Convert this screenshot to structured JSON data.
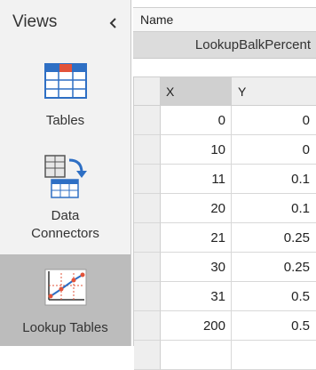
{
  "views_panel": {
    "title": "Views",
    "collapse_icon": "chevron-left-icon",
    "items": [
      {
        "label_lines": [
          "Tables"
        ],
        "icon": "table-icon",
        "active": false
      },
      {
        "label_lines": [
          "Data",
          "Connectors"
        ],
        "icon": "data-connector-icon",
        "active": false
      },
      {
        "label_lines": [
          "Lookup Tables"
        ],
        "icon": "lookup-chart-icon",
        "active": true
      }
    ]
  },
  "name_field": {
    "header": "Name",
    "value": "LookupBalkPercent"
  },
  "grid": {
    "columns": [
      "X",
      "Y"
    ],
    "rows": [
      {
        "x": "0",
        "y": "0"
      },
      {
        "x": "10",
        "y": "0"
      },
      {
        "x": "11",
        "y": "0.1"
      },
      {
        "x": "20",
        "y": "0.1"
      },
      {
        "x": "21",
        "y": "0.25"
      },
      {
        "x": "30",
        "y": "0.25"
      },
      {
        "x": "31",
        "y": "0.5"
      },
      {
        "x": "200",
        "y": "0.5"
      }
    ]
  },
  "colors": {
    "accent_blue": "#2e6fc4",
    "accent_red": "#e2533a",
    "active_bg": "#bcbcbc"
  }
}
